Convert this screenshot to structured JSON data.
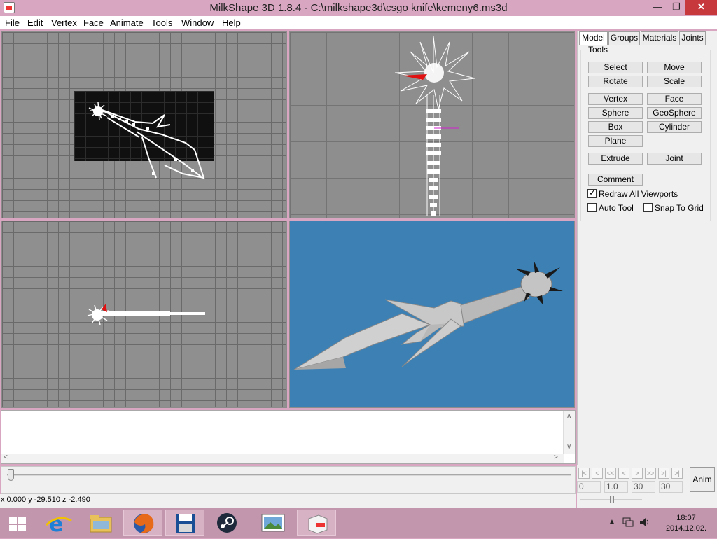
{
  "window": {
    "title": "MilkShape 3D 1.8.4 - C:\\milkshape3d\\csgo knife\\kemeny6.ms3d",
    "min_glyph": "—",
    "max_glyph": "❐",
    "close_glyph": "✕"
  },
  "menu": [
    "File",
    "Edit",
    "Vertex",
    "Face",
    "Animate",
    "Tools",
    "Window",
    "Help"
  ],
  "panel": {
    "tabs": [
      "Model",
      "Groups",
      "Materials",
      "Joints"
    ],
    "active_tab": "Model",
    "tools_legend": "Tools",
    "buttons": {
      "select": "Select",
      "move": "Move",
      "rotate": "Rotate",
      "scale": "Scale",
      "vertex": "Vertex",
      "face": "Face",
      "sphere": "Sphere",
      "geosphere": "GeoSphere",
      "box": "Box",
      "cylinder": "Cylinder",
      "plane": "Plane",
      "extrude": "Extrude",
      "joint": "Joint",
      "comment": "Comment"
    },
    "checkboxes": {
      "redraw_all": {
        "label": "Redraw All Viewports",
        "checked": true
      },
      "auto_tool": {
        "label": "Auto Tool",
        "checked": false
      },
      "snap_to_grid": {
        "label": "Snap To Grid",
        "checked": false
      }
    }
  },
  "animation": {
    "nav_glyphs": [
      "|<",
      "<",
      "<<",
      "<",
      ">",
      ">>",
      ">|",
      ">|"
    ],
    "fields": [
      "0",
      "1.0",
      "30",
      "30"
    ],
    "anim_label": "Anim"
  },
  "status": {
    "coords": "x 0.000 y -29.510 z -2.490"
  },
  "taskbar": {
    "apps": [
      "internet-explorer",
      "file-explorer",
      "firefox",
      "save-tool",
      "steam",
      "photo-viewer",
      "milkshape"
    ],
    "clock_time": "18:07",
    "clock_date": "2014.12.02."
  },
  "colors": {
    "title_bg": "#d9a6c1",
    "taskbar_bg": "#c296ad",
    "viewport_grid": "#8f8f8f",
    "viewport_3d_bg": "#3c80b4",
    "close_button": "#c7383d"
  }
}
